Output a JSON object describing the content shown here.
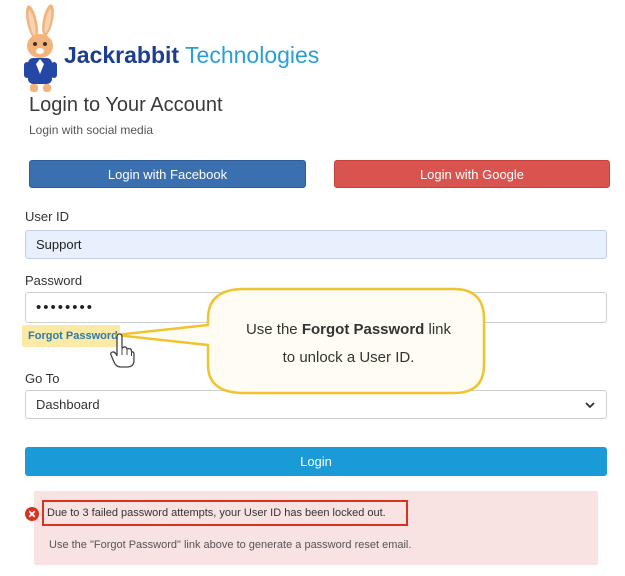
{
  "brand": {
    "name_bold": "Jackrabbit",
    "name_light": " Technologies"
  },
  "page": {
    "title": "Login to Your Account",
    "subtitle": "Login with social media"
  },
  "social": {
    "facebook_label": "Login with Facebook",
    "google_label": "Login with Google"
  },
  "form": {
    "userid_label": "User ID",
    "userid_value": "Support",
    "password_label": "Password",
    "password_value": "••••••••",
    "forgot_label": "Forgot Password",
    "goto_label": "Go To",
    "goto_value": "Dashboard",
    "login_label": "Login"
  },
  "callout": {
    "pre": "Use the ",
    "bold": "Forgot Password",
    "post": " link",
    "line2": "to unlock a User ID."
  },
  "alert": {
    "line1": "Due to 3 failed password attempts, your User ID has been locked out.",
    "line2": "Use the \"Forgot Password\" link above to generate a password reset email."
  },
  "colors": {
    "facebook": "#3a6fb0",
    "google": "#d9534f",
    "login": "#1a9ad6",
    "alert_bg": "#f8e2e2",
    "highlight": "#d9331f",
    "callout_border": "#f0c330"
  }
}
